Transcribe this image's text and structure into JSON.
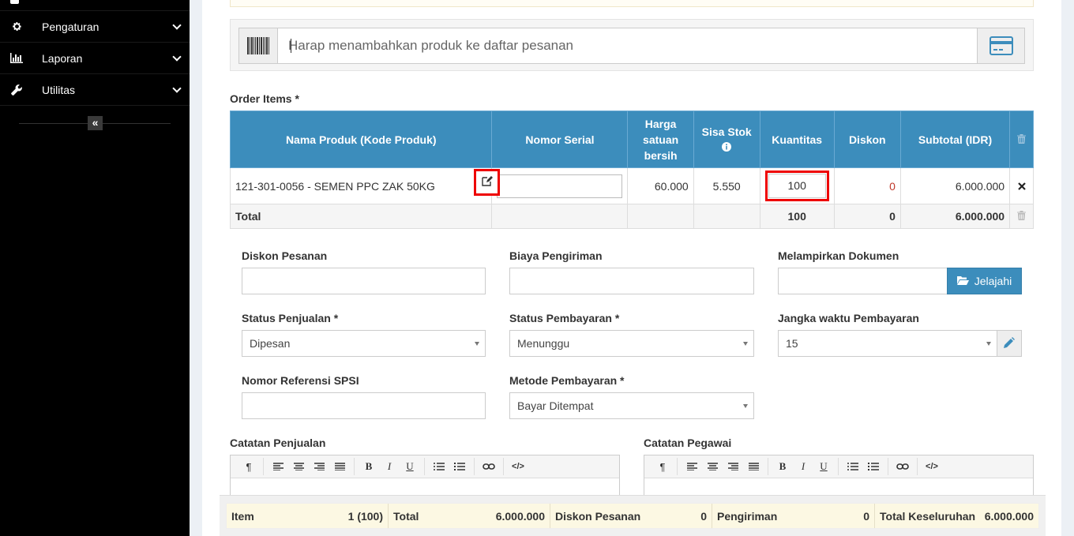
{
  "sidebar": {
    "items": [
      {
        "label": "Pengaturan",
        "icon": "gear-icon"
      },
      {
        "label": "Laporan",
        "icon": "bar-chart-icon"
      },
      {
        "label": "Utilitas",
        "icon": "wrench-icon"
      }
    ],
    "collapse_symbol": "«"
  },
  "search": {
    "placeholder": "Harap menambahkan produk ke daftar pesanan"
  },
  "order_items": {
    "title": "Order Items *",
    "headers": [
      "Nama Produk (Kode Produk)",
      "Nomor Serial",
      "Harga satuan bersih",
      "Sisa Stok",
      "Kuantitas",
      "Diskon",
      "Subtotal (IDR)"
    ],
    "rows": [
      {
        "product": "121-301-0056 - SEMEN PPC ZAK 50KG",
        "serial": "",
        "price": "60.000",
        "stock": "5.550",
        "qty": "100",
        "discount": "0",
        "subtotal": "6.000.000"
      }
    ],
    "total": {
      "label": "Total",
      "qty": "100",
      "discount": "0",
      "subtotal": "6.000.000"
    }
  },
  "form": {
    "order_discount_label": "Diskon Pesanan",
    "shipping_label": "Biaya Pengiriman",
    "attach_label": "Melampirkan Dokumen",
    "browse_label": "Jelajahi",
    "sale_status_label": "Status Penjualan *",
    "sale_status_value": "Dipesan",
    "payment_status_label": "Status Pembayaran *",
    "payment_status_value": "Menunggu",
    "payment_term_label": "Jangka waktu Pembayaran",
    "payment_term_value": "15",
    "spsi_label": "Nomor Referensi SPSI",
    "payment_method_label": "Metode Pembayaran *",
    "payment_method_value": "Bayar Ditempat"
  },
  "notes": {
    "sale_note_label": "Catatan Penjualan",
    "staff_note_label": "Catatan Pegawai",
    "toolbar": {
      "paragraph": "¶",
      "bold": "B",
      "italic": "I",
      "underline": "U",
      "code": "</>"
    }
  },
  "summary": {
    "item_label": "Item",
    "item_value": "1 (100)",
    "total_label": "Total",
    "total_value": "6.000.000",
    "discount_label": "Diskon Pesanan",
    "discount_value": "0",
    "shipping_label": "Pengiriman",
    "shipping_value": "0",
    "grand_label": "Total Keseluruhan",
    "grand_value": "6.000.000"
  },
  "colors": {
    "primary": "#3c8dbc",
    "highlight": "#e00000",
    "sidebar": "#000000"
  }
}
